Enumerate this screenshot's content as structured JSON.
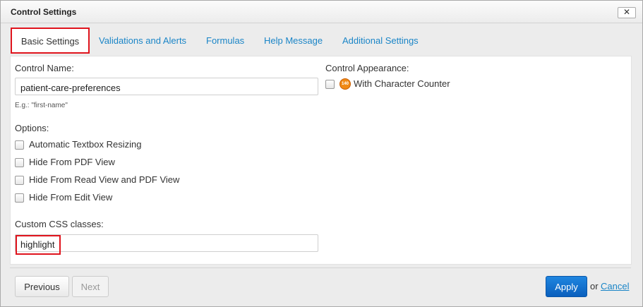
{
  "window": {
    "title": "Control Settings",
    "close_label": "✕"
  },
  "tabs": [
    {
      "label": "Basic Settings",
      "active": true
    },
    {
      "label": "Validations and Alerts"
    },
    {
      "label": "Formulas"
    },
    {
      "label": "Help Message"
    },
    {
      "label": "Additional Settings"
    }
  ],
  "form": {
    "control_name_label": "Control Name:",
    "control_name_value": "patient-care-preferences",
    "control_name_hint": "E.g.: \"first-name\"",
    "options_label": "Options:",
    "options": [
      {
        "label": "Automatic Textbox Resizing",
        "checked": false
      },
      {
        "label": "Hide From PDF View",
        "checked": false
      },
      {
        "label": "Hide From Read View and PDF View",
        "checked": false
      },
      {
        "label": "Hide From Edit View",
        "checked": false
      }
    ],
    "css_label": "Custom CSS classes:",
    "css_value": "highlight",
    "appearance_label": "Control Appearance:",
    "appearance_option": {
      "label": "With Character Counter",
      "checked": false,
      "icon_text": "140"
    }
  },
  "footer": {
    "previous_label": "Previous",
    "next_label": "Next",
    "apply_label": "Apply",
    "or_text": "or",
    "cancel_label": "Cancel"
  },
  "colors": {
    "accent": "#1a85c7",
    "highlight_red": "#e0141d",
    "apply_blue": "#0a5fbd"
  }
}
